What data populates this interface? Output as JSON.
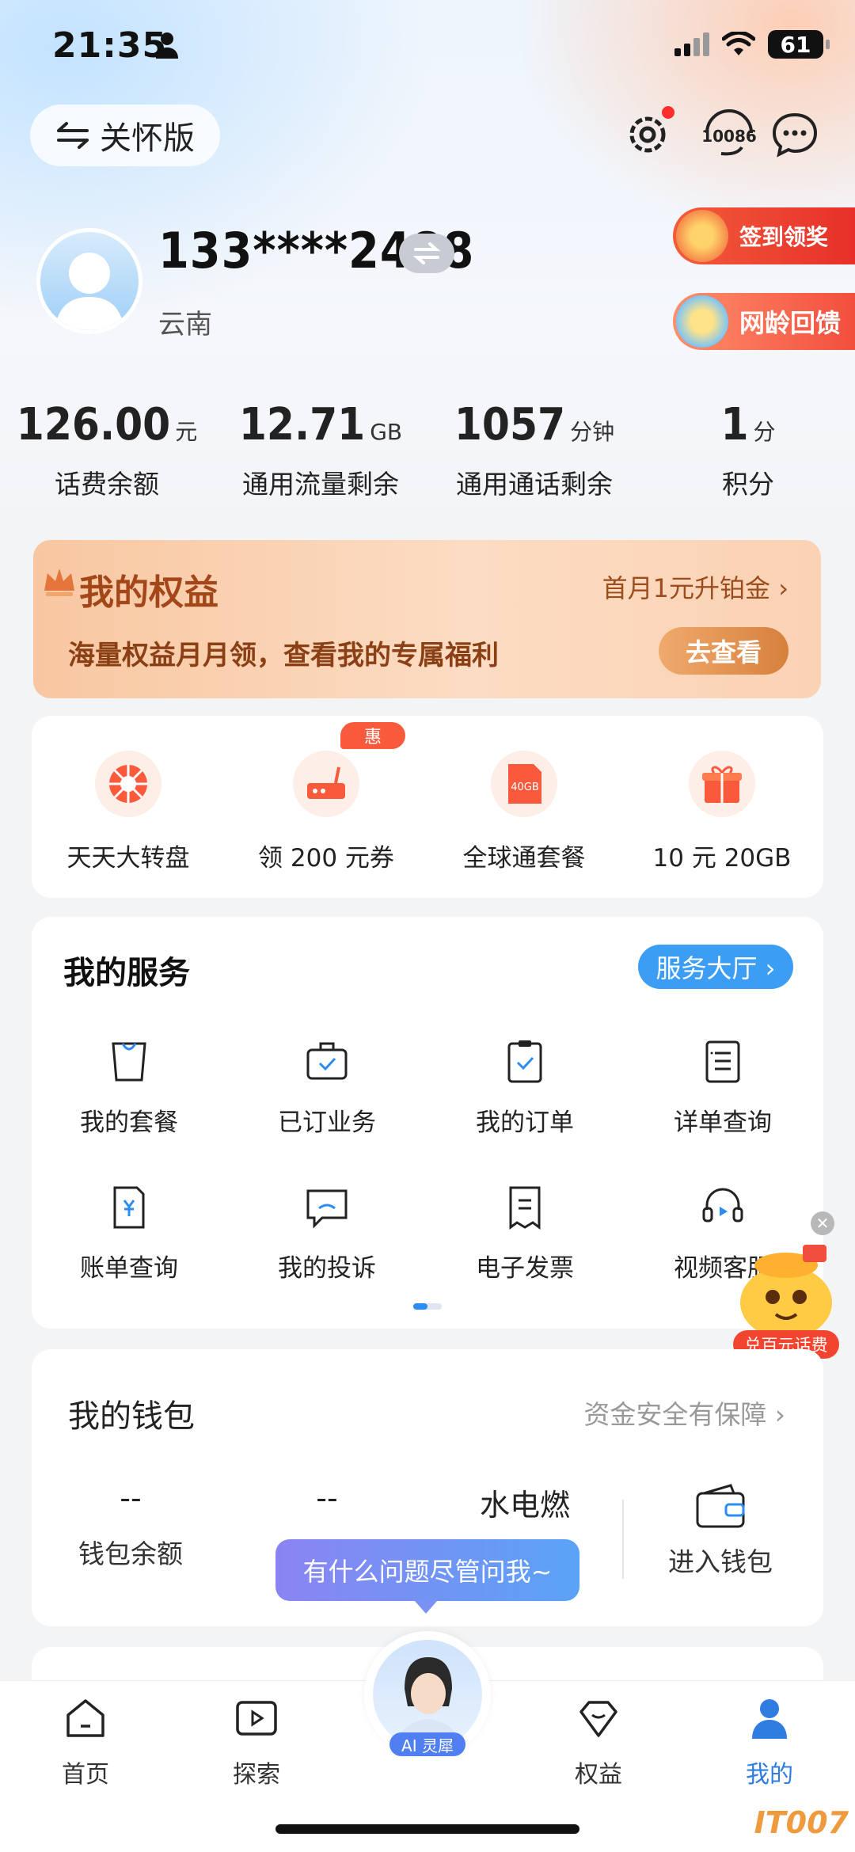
{
  "status_bar": {
    "time": "21:35",
    "battery": "61"
  },
  "header": {
    "care_mode_label": "关怀版",
    "hotline_label": "10086"
  },
  "profile": {
    "phone": "133****2488",
    "province": "云南"
  },
  "promos": {
    "checkin": "签到领奖",
    "network_age": "网龄回馈"
  },
  "stats": [
    {
      "value": "126.00",
      "unit": "元",
      "label": "话费余额"
    },
    {
      "value": "12.71",
      "unit": "GB",
      "label": "通用流量剩余"
    },
    {
      "value": "1057",
      "unit": "分钟",
      "label": "通用通话剩余"
    },
    {
      "value": "1",
      "unit": "分",
      "label": "积分"
    }
  ],
  "benefits": {
    "title": "我的权益",
    "upgrade": "首月1元升铂金 ›",
    "subtitle": "海量权益月月领，查看我的专属福利",
    "button": "去查看"
  },
  "quick_actions": {
    "badge": "惠",
    "items": [
      {
        "label": "天天大转盘",
        "icon": "wheel-icon"
      },
      {
        "label": "领 200 元券",
        "icon": "router-icon"
      },
      {
        "label": "全球通套餐",
        "icon": "sim-40gb-icon",
        "icon_text": "40GB"
      },
      {
        "label": "10 元 20GB",
        "icon": "gift-icon"
      }
    ]
  },
  "services": {
    "title": "我的服务",
    "hall_button": "服务大厅 ›",
    "items": [
      {
        "label": "我的套餐",
        "icon": "bag-icon"
      },
      {
        "label": "已订业务",
        "icon": "briefcase-check-icon"
      },
      {
        "label": "我的订单",
        "icon": "clipboard-check-icon"
      },
      {
        "label": "详单查询",
        "icon": "list-doc-icon"
      },
      {
        "label": "账单查询",
        "icon": "bill-yen-icon"
      },
      {
        "label": "我的投诉",
        "icon": "complaint-chat-icon"
      },
      {
        "label": "电子发票",
        "icon": "invoice-icon"
      },
      {
        "label": "视频客服",
        "icon": "headset-video-icon"
      }
    ]
  },
  "wallet": {
    "title": "我的钱包",
    "safety": "资金安全有保障 ›",
    "cols": [
      {
        "value": "--",
        "label": "钱包余额"
      },
      {
        "value": "--",
        "label": ""
      },
      {
        "value": "水电燃",
        "label": ""
      }
    ],
    "enter_label": "进入钱包"
  },
  "assistant_bubble": "有什么问题尽管问我~",
  "float_badge": "兑百元话费",
  "tabbar": {
    "items": [
      {
        "label": "首页",
        "icon": "home-icon"
      },
      {
        "label": "探索",
        "icon": "play-icon"
      },
      {
        "label": "权益",
        "icon": "diamond-icon"
      },
      {
        "label": "我的",
        "icon": "person-icon",
        "active": true
      }
    ],
    "ai_badge": "AI 灵犀"
  },
  "watermark": "IT007",
  "colors": {
    "accent": "#2f7de1",
    "benefit_brown": "#a3471a",
    "promo_red": "#e8392f"
  }
}
